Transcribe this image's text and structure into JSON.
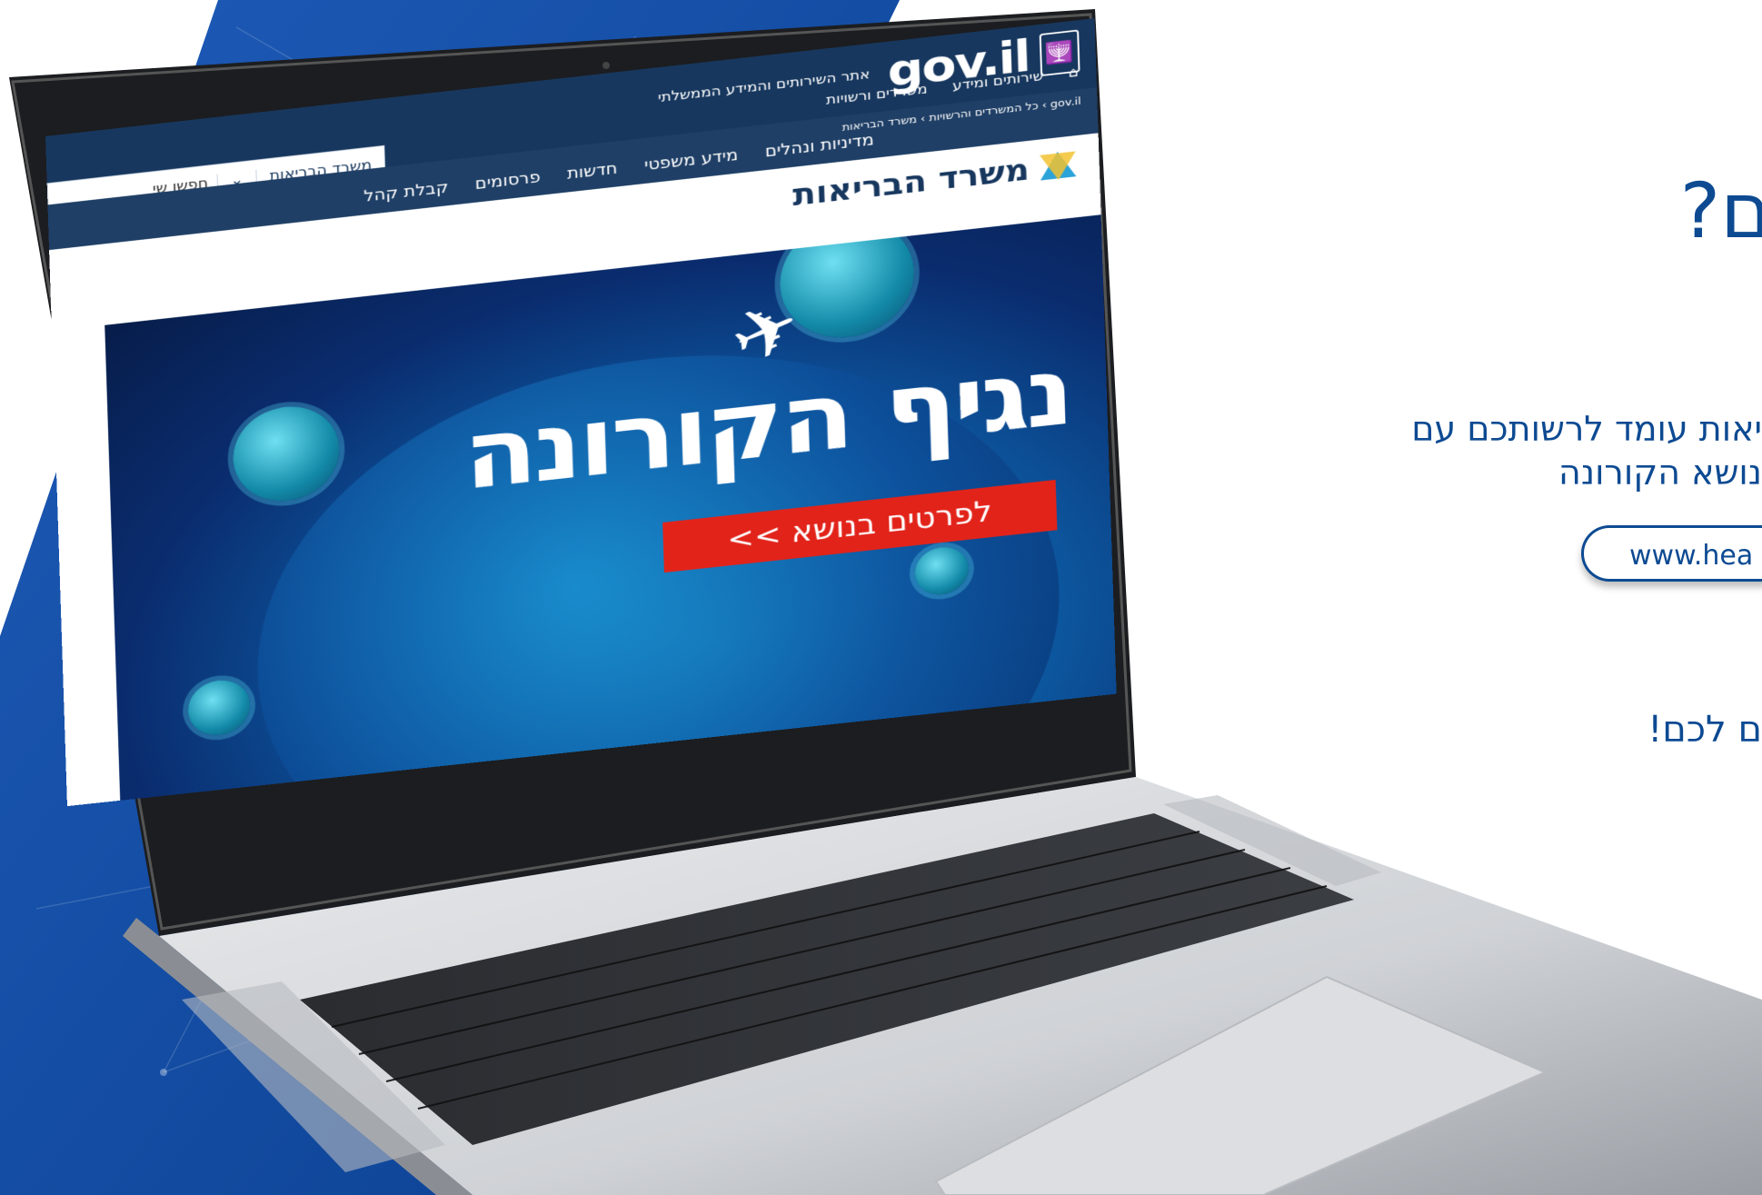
{
  "right_panel": {
    "headline": "ם?",
    "paragraph_line1": "יאות עומד לרשותכם עם",
    "paragraph_line2": "נושא הקורונה",
    "url": "www.hea",
    "thanks": "ם לכם!"
  },
  "screen": {
    "gov_tagline": "אתר השירותים והמידע הממשלתי",
    "gov_word": "gov.il",
    "top_nav": [
      "שירותים ומידע",
      "משרדים ורשויות",
      "מדיניות ונהלים",
      "מידע משפטי",
      "חדשות",
      "פרסומים",
      "קבלת קהל"
    ],
    "ministry_select_label": "משרד הבריאות",
    "search_label": "חפשו שי",
    "breadcrumb": "gov.il › כל המשרדים והרשויות › משרד הבריאות",
    "ministry_title": "משרד הבריאות",
    "banner_headline": "נגיף הקורונה",
    "banner_cta": "לפרטים בנושא >>"
  },
  "colors": {
    "brand_blue": "#0d4a92",
    "gov_navy": "#17375e",
    "cta_red": "#e2231a"
  },
  "icons": [
    "home-icon",
    "chevron-down-icon",
    "search-icon",
    "menorah-emblem-icon",
    "airplane-icon",
    "virus-icon"
  ]
}
